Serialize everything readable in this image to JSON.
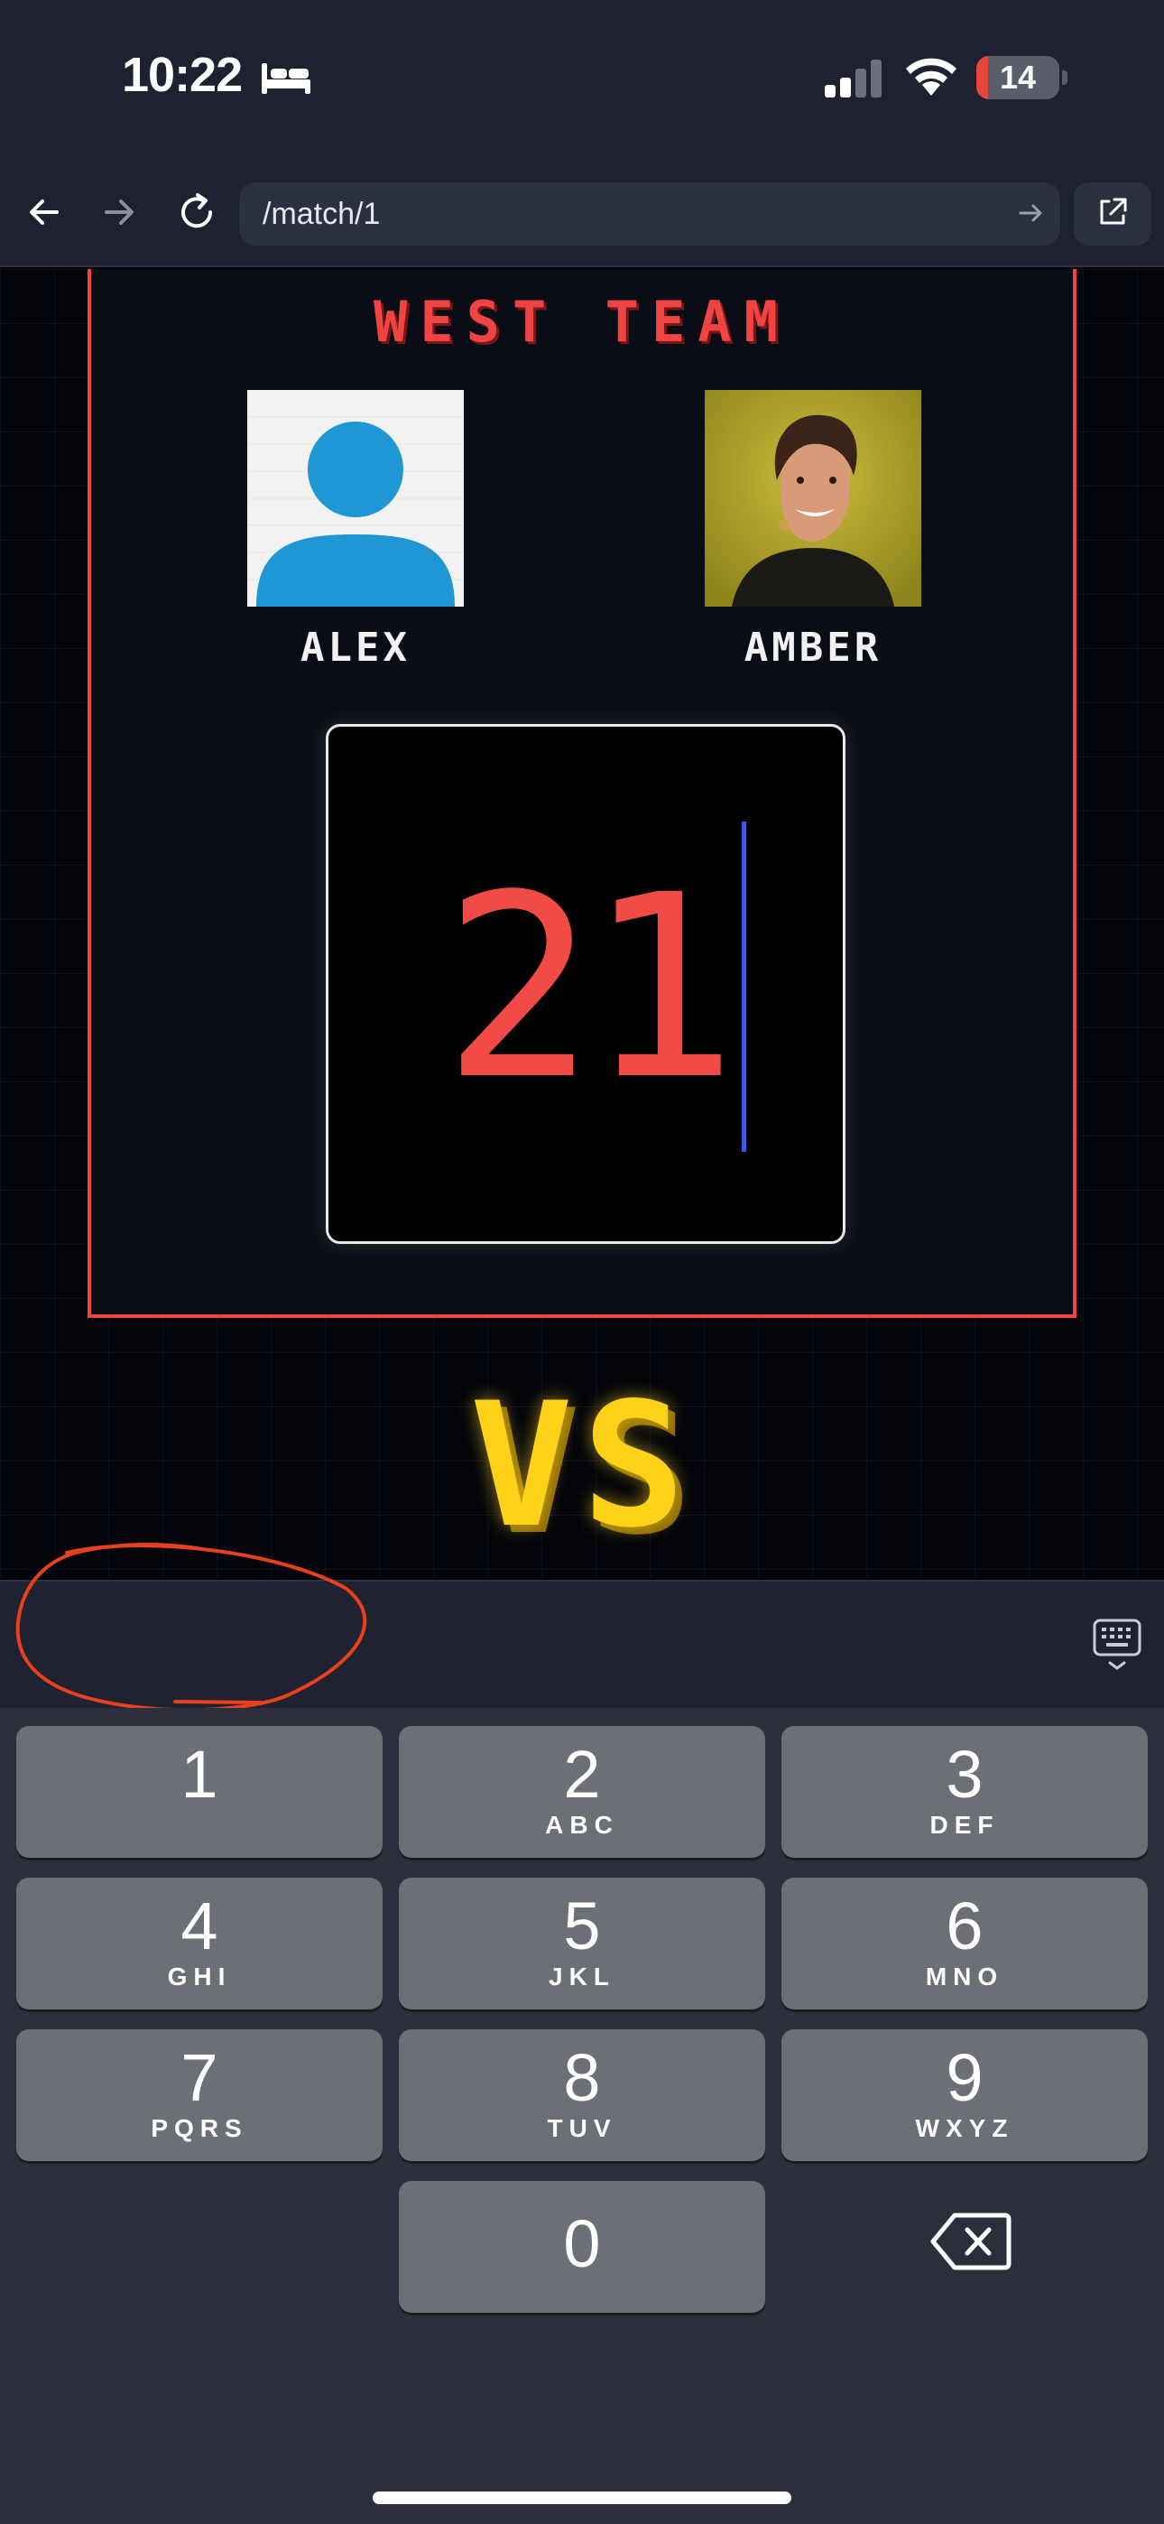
{
  "status_bar": {
    "time": "10:22",
    "battery_level": "14",
    "battery_fraction": 0.14,
    "battery_color": "#e8453c",
    "icons": [
      "bed-icon",
      "cellular-signal-icon",
      "wifi-icon",
      "battery-icon"
    ]
  },
  "browser": {
    "url": "/match/1",
    "icons": [
      "back-arrow-icon",
      "forward-arrow-icon",
      "reload-icon",
      "go-arrow-icon",
      "share-icon"
    ]
  },
  "match": {
    "team_name": "WEST TEAM",
    "team_color": "#ef4444",
    "players": [
      {
        "name": "ALEX",
        "photo": "default-avatar-icon"
      },
      {
        "name": "AMBER",
        "photo": "player-photo"
      }
    ],
    "score": "21",
    "vs_label": "VS",
    "vs_color": "#ffd21a"
  },
  "keypad": {
    "keys": [
      {
        "num": "1",
        "letters": ""
      },
      {
        "num": "2",
        "letters": "ABC"
      },
      {
        "num": "3",
        "letters": "DEF"
      },
      {
        "num": "4",
        "letters": "GHI"
      },
      {
        "num": "5",
        "letters": "JKL"
      },
      {
        "num": "6",
        "letters": "MNO"
      },
      {
        "num": "7",
        "letters": "PQRS"
      },
      {
        "num": "8",
        "letters": "TUV"
      },
      {
        "num": "9",
        "letters": "WXYZ"
      },
      {
        "num": "0",
        "letters": ""
      }
    ],
    "icons": [
      "keyboard-dismiss-icon",
      "backspace-icon"
    ]
  }
}
